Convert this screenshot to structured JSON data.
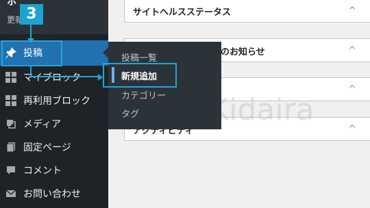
{
  "sidebar": {
    "site_name_partial": "ホ",
    "update_text_partial": "更新",
    "items": [
      {
        "label": "投稿",
        "icon": "pin-icon"
      },
      {
        "label": "マイブロック",
        "icon": "grid-icon"
      },
      {
        "label": "再利用ブロック",
        "icon": "grid-icon"
      },
      {
        "label": "メディア",
        "icon": "media-icon"
      },
      {
        "label": "固定ページ",
        "icon": "pages-icon"
      },
      {
        "label": "コメント",
        "icon": "comment-icon"
      },
      {
        "label": "お問い合わせ",
        "icon": "mail-icon"
      }
    ]
  },
  "submenu": {
    "items": [
      {
        "label": "投稿一覧",
        "current": false
      },
      {
        "label": "新規追加",
        "current": true
      },
      {
        "label": "カテゴリー",
        "current": false
      },
      {
        "label": "タグ",
        "current": false
      }
    ]
  },
  "widgets": [
    {
      "title": "サイトヘルスステータス",
      "caret": "^"
    },
    {
      "title": "のお知らせ",
      "caret": "^"
    },
    {
      "title": "",
      "caret": "^"
    },
    {
      "title": "アクティビティ",
      "caret": "^"
    }
  ],
  "annotation": {
    "step_number": "3",
    "color": "#22a6d6"
  },
  "colors": {
    "sidebar_bg": "#1d2327",
    "active_bg": "#2271b1",
    "flyout_bg": "#2c3338",
    "content_bg": "#f0f0f1"
  },
  "watermark": "@Kidaira"
}
